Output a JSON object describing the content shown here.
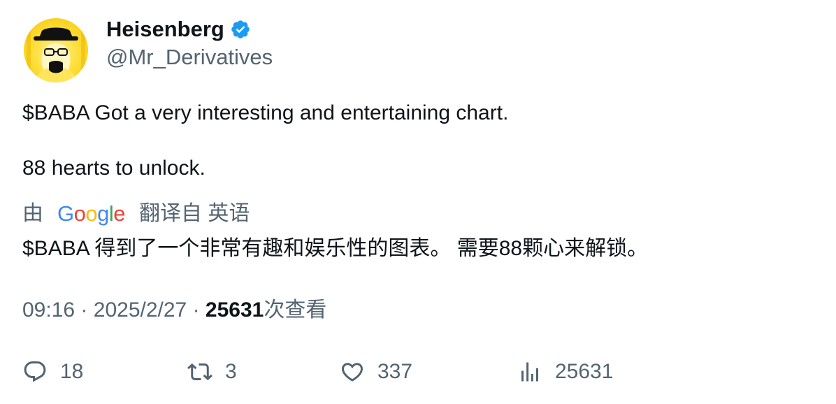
{
  "author": {
    "name": "Heisenberg",
    "handle": "@Mr_Derivatives",
    "verified_icon": "verified-badge-icon",
    "accent": "#1d9bf0"
  },
  "tweet": {
    "line1": "$BABA Got a very interesting and entertaining chart.",
    "line2": "88 hearts to unlock."
  },
  "translation": {
    "prefix": "由",
    "brand_letters": [
      "G",
      "o",
      "o",
      "g",
      "l",
      "e"
    ],
    "suffix": "翻译自 英语",
    "text": "$BABA 得到了一个非常有趣和娱乐性的图表。 需要88颗心来解锁。"
  },
  "meta": {
    "time": "09:16",
    "separator": "·",
    "date": "2025/2/27",
    "views_count": "25631",
    "views_label": "次查看"
  },
  "actions": {
    "replies": "18",
    "reposts": "3",
    "likes": "337",
    "views": "25631"
  }
}
